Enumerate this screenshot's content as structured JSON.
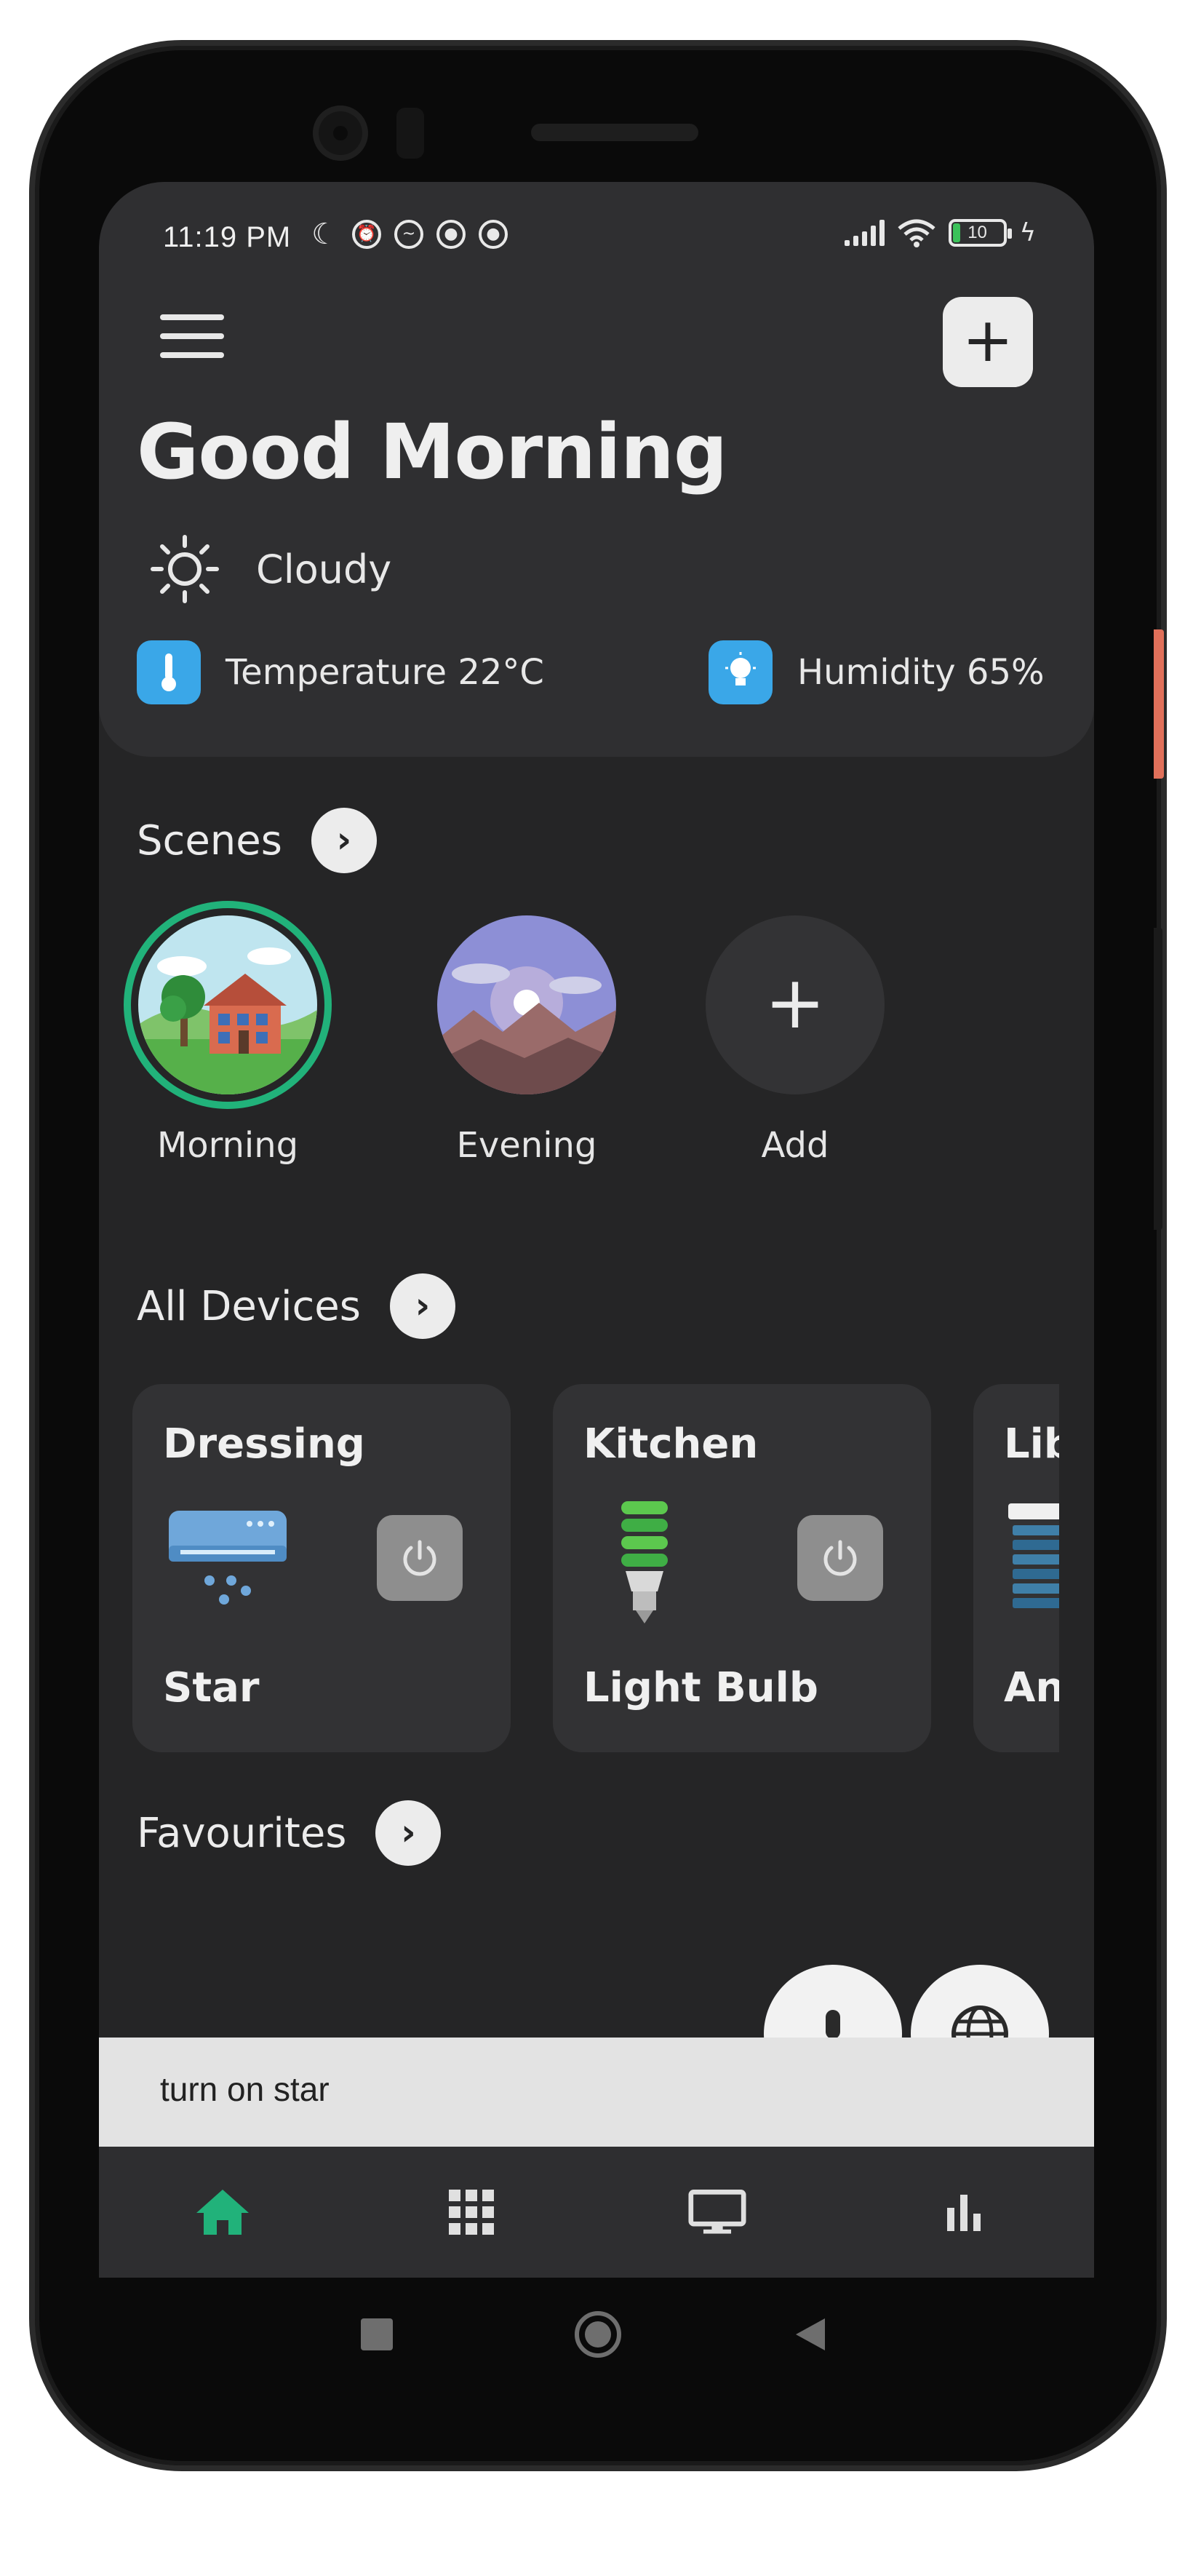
{
  "status_bar": {
    "time": "11:19 PM",
    "battery": "10"
  },
  "header": {
    "greeting": "Good Morning",
    "add_button_label": "+"
  },
  "weather": {
    "condition": "Cloudy",
    "temperature_label": "Temperature 22°C",
    "humidity_label": "Humidity 65%"
  },
  "scenes": {
    "title": "Scenes",
    "items": [
      {
        "label": "Morning",
        "active": true
      },
      {
        "label": "Evening",
        "active": false
      },
      {
        "label": "Add",
        "active": false
      }
    ],
    "add_symbol": "+"
  },
  "devices": {
    "title": "All Devices",
    "items": [
      {
        "room": "Dressing",
        "name": "Star",
        "icon": "air-conditioner-icon"
      },
      {
        "room": "Kitchen",
        "name": "Light Bulb",
        "icon": "light-bulb-icon"
      },
      {
        "room": "Library",
        "name": "Angle",
        "icon": "blinds-icon"
      }
    ]
  },
  "favourites": {
    "title": "Favourites"
  },
  "voice": {
    "transcript": "turn on star"
  },
  "bottom_nav": [
    {
      "name": "home",
      "active": true
    },
    {
      "name": "apps"
    },
    {
      "name": "screen"
    },
    {
      "name": "stats"
    }
  ],
  "colors": {
    "accent": "#21b27a",
    "background": "#252526",
    "panel": "#2f2f31",
    "info_blue": "#3aa7e8"
  }
}
